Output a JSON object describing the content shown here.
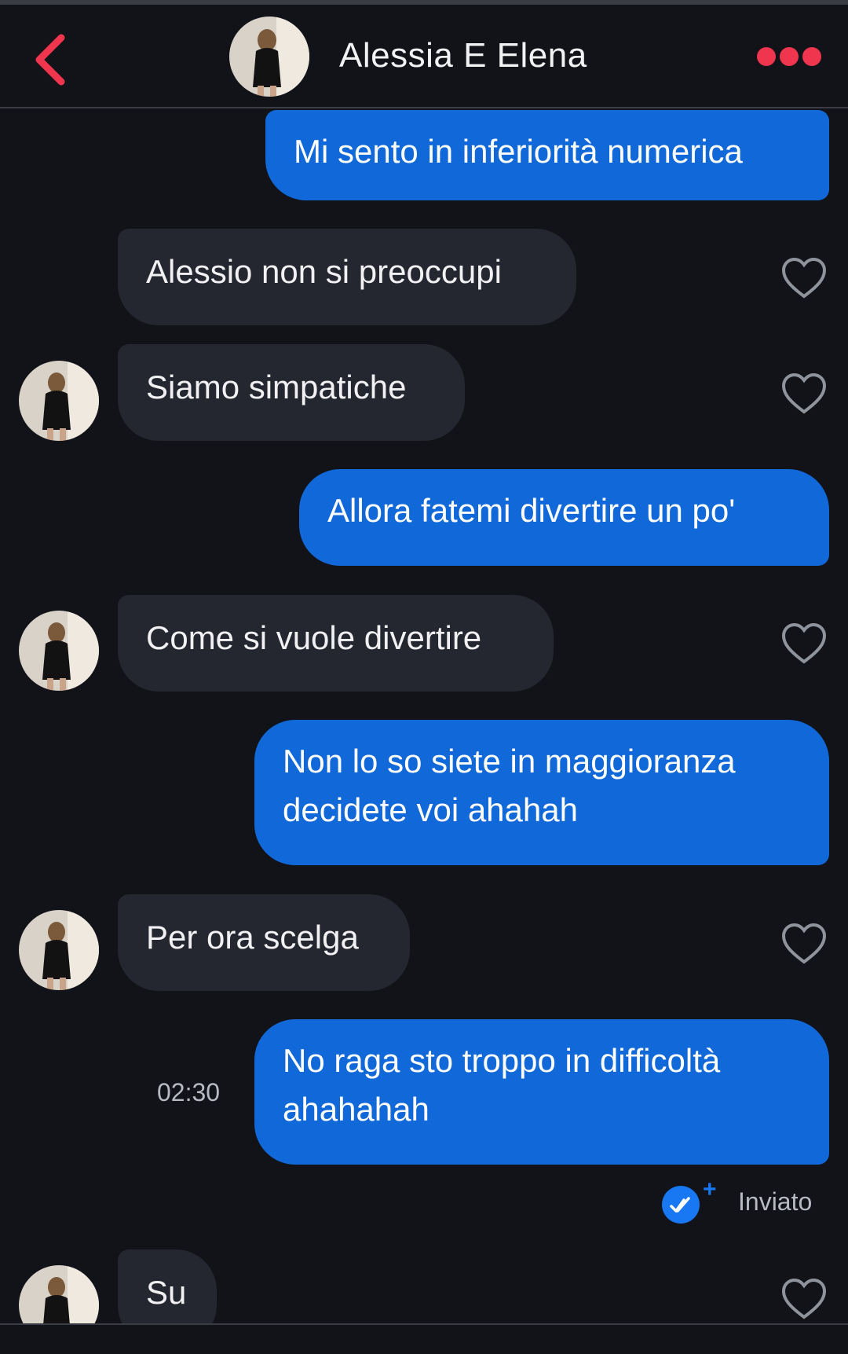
{
  "header": {
    "title": "Alessia E Elena",
    "back_icon": "chevron-left-icon",
    "more_icon": "more-dots-icon",
    "accent": "#f0354f"
  },
  "colors": {
    "background": "#111318",
    "outgoing_bubble": "#1169d9",
    "incoming_bubble": "#24272f"
  },
  "messages": [
    {
      "dir": "out",
      "text": "Mi sento in inferiorità numerica"
    },
    {
      "dir": "in",
      "text": "Alessio non si preoccupi"
    },
    {
      "dir": "in",
      "text": "Siamo simpatiche"
    },
    {
      "dir": "out",
      "text": "Allora fatemi divertire un po'"
    },
    {
      "dir": "in",
      "text": "Come si vuole divertire"
    },
    {
      "dir": "out",
      "text": "Non lo so siete in maggioranza decidete voi ahahah"
    },
    {
      "dir": "in",
      "text": "Per ora scelga"
    },
    {
      "dir": "out",
      "text": "No raga sto troppo in difficoltà ahahahah"
    },
    {
      "dir": "in",
      "text": "Su"
    }
  ],
  "last_message": {
    "time": "02:30",
    "status": "Inviato",
    "status_icon": "double-check-icon"
  }
}
